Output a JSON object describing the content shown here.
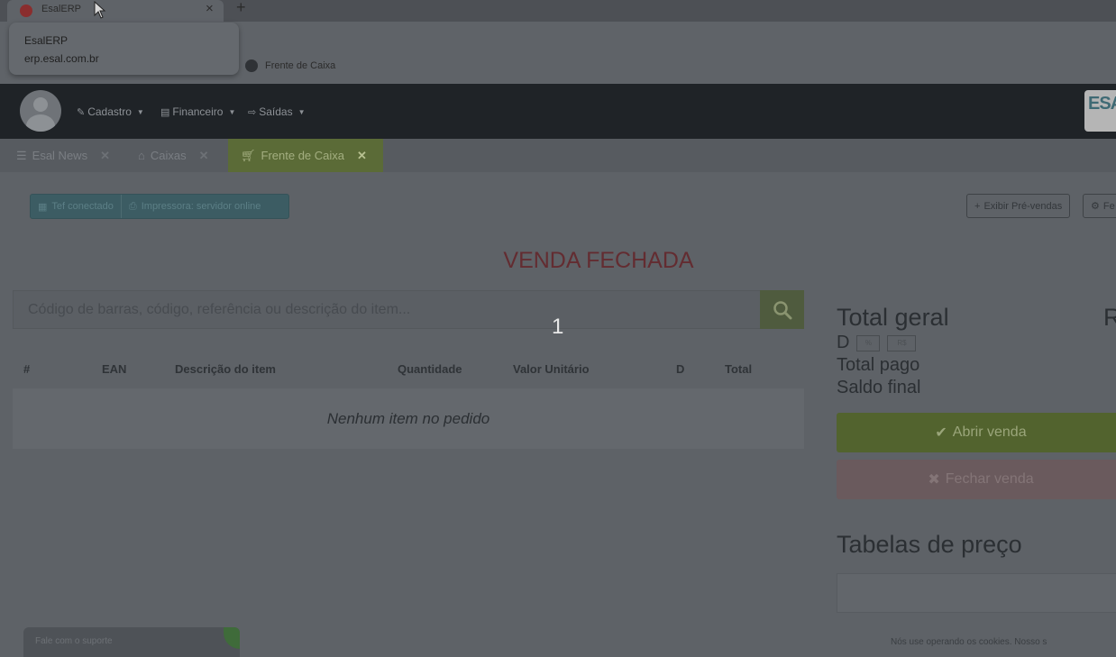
{
  "browser": {
    "tab_title": "EsalERP",
    "popup_title": "EsalERP",
    "popup_url": "erp.esal.com.br",
    "bookmark": "Frente de Caixa"
  },
  "nav": {
    "menus": [
      "Cadastro",
      "Financeiro",
      "Saídas"
    ],
    "logo_text": "ESA"
  },
  "tabs": [
    "Esal News",
    "Caixas",
    "Frente de Caixa"
  ],
  "status": {
    "tef": "Tef conectado",
    "printer": "Impressora: servidor online"
  },
  "buttons": {
    "pre_sales": "Exibir Pré-vendas",
    "fe": "Fe"
  },
  "sale_state": "VENDA FECHADA",
  "search": {
    "placeholder": "Código de barras, código, referência ou descrição do item..."
  },
  "counter": "1",
  "table": {
    "columns": [
      "#",
      "EAN",
      "Descrição do item",
      "Quantidade",
      "Valor Unitário",
      "D",
      "Total"
    ],
    "empty": "Nenhum item no pedido"
  },
  "summary": {
    "total_label": "Total geral",
    "total_value": "R",
    "discount_label": "D",
    "pct": "%",
    "currency": "R$",
    "paid_label": "Total pago",
    "balance_label": "Saldo final"
  },
  "actions": {
    "open": "Abrir venda",
    "close": "Fechar venda"
  },
  "price_tables": {
    "title": "Tabelas de preço"
  },
  "support": "Fale com o suporte",
  "footer": "Nós use operando os cookies. Nosso s"
}
